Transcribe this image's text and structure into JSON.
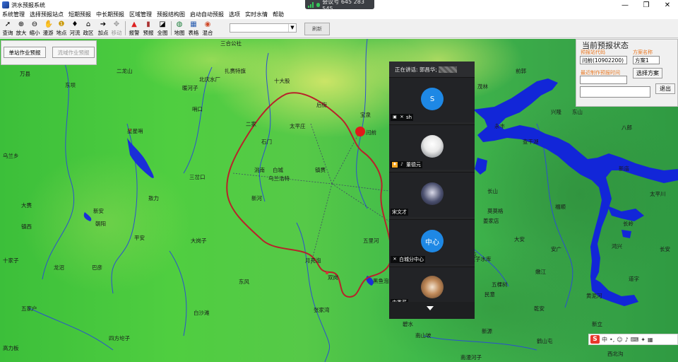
{
  "window": {
    "title": "洪水预报系统",
    "meeting_label": "会议号 645 283 545",
    "controls": {
      "minimize": "—",
      "maximize": "❐",
      "close": "✕"
    }
  },
  "menu": [
    "系统管理",
    "选择预报站点",
    "短期预报",
    "中长期预报",
    "区域管理",
    "预报结构图",
    "启动自动预报",
    "选项",
    "实时水情",
    "帮助"
  ],
  "toolbar": {
    "buttons": [
      {
        "label": "查询",
        "icon": "pointer-icon"
      },
      {
        "label": "放大",
        "icon": "zoom-in-icon"
      },
      {
        "label": "缩小",
        "icon": "zoom-out-icon"
      },
      {
        "label": "漫游",
        "icon": "hand-icon"
      },
      {
        "label": "地点",
        "icon": "info-icon"
      },
      {
        "label": "河流",
        "icon": "pin-icon"
      },
      {
        "label": "政区",
        "icon": "home-icon"
      },
      {
        "label": "加点",
        "icon": "arrow-icon"
      },
      {
        "label": "移动",
        "icon": "move-icon"
      },
      {
        "label": "报警",
        "icon": "alarm-icon"
      },
      {
        "label": "预报",
        "icon": "book-icon"
      },
      {
        "label": "全图",
        "icon": "chart-icon"
      },
      {
        "label": "地图",
        "icon": "globe-icon"
      },
      {
        "label": "表格",
        "icon": "table-icon"
      },
      {
        "label": "混合",
        "icon": "mix-icon"
      }
    ],
    "refresh_label": "刷新"
  },
  "left_panel": {
    "single_station_btn": "单站作业预报",
    "basin_btn": "流域作业预报"
  },
  "status_panel": {
    "title": "当前预报状态",
    "station_code_label": "预报站代码",
    "plan_name_label": "方案名称",
    "station_value": "闫前(10902200)",
    "plan_value": "方案1",
    "recent_time_label": "最近制作预报时间",
    "recent_time_value": "",
    "select_plan_btn": "选择方案",
    "exit_btn": "退出",
    "exit_field_value": ""
  },
  "video_panel": {
    "speaking_label": "正在讲话: 郭昌华;",
    "participants": [
      {
        "avatar_text": "S",
        "name": "sh",
        "avatar_color": "#1e88e5"
      },
      {
        "avatar_text": "",
        "name": "董德元",
        "avatar_color": "#cfd3d6"
      },
      {
        "avatar_text": "",
        "name": "宋文才",
        "avatar_color": "#3a3f56"
      },
      {
        "avatar_text": "中心",
        "name": "白城分中心",
        "avatar_color": "#1e88e5"
      },
      {
        "avatar_text": "",
        "name": "史秀芹",
        "avatar_color": "#b97a4e"
      }
    ]
  },
  "map_labels": [
    {
      "text": "三合公社"
    },
    {
      "text": "万县"
    },
    {
      "text": "二龙山"
    },
    {
      "text": "北庆水厂"
    },
    {
      "text": "扎赉特旗"
    },
    {
      "text": "暖河子"
    },
    {
      "text": "哨口"
    },
    {
      "text": "星星哨"
    },
    {
      "text": "十大股"
    },
    {
      "text": "后街"
    },
    {
      "text": "二家"
    },
    {
      "text": "太平庄"
    },
    {
      "text": "石门"
    },
    {
      "text": "宝泉"
    },
    {
      "text": "闫前"
    },
    {
      "text": "白城"
    },
    {
      "text": "洮南"
    },
    {
      "text": "镇赉"
    },
    {
      "text": "乌兰浩特"
    },
    {
      "text": "三岔口"
    },
    {
      "text": "东坝"
    },
    {
      "text": "大赉"
    },
    {
      "text": "新安"
    },
    {
      "text": "朝阳"
    },
    {
      "text": "大岗子"
    },
    {
      "text": "平安"
    },
    {
      "text": "五里河"
    },
    {
      "text": "月亮泡"
    },
    {
      "text": "龙沼"
    },
    {
      "text": "镇西"
    },
    {
      "text": "双岗"
    },
    {
      "text": "黑鱼泡"
    },
    {
      "text": "张家湾"
    },
    {
      "text": "东风"
    },
    {
      "text": "白沙滩"
    },
    {
      "text": "五家户"
    },
    {
      "text": "四方坨子"
    },
    {
      "text": "高力板"
    },
    {
      "text": "茂林"
    },
    {
      "text": "前郭"
    },
    {
      "text": "查干湖"
    },
    {
      "text": "长山"
    },
    {
      "text": "莫莫格"
    },
    {
      "text": "姜家店"
    },
    {
      "text": "三家子水库"
    },
    {
      "text": "大安"
    },
    {
      "text": "嫩江"
    },
    {
      "text": "安广"
    },
    {
      "text": "五棵树"
    },
    {
      "text": "民意"
    },
    {
      "text": "乾安"
    },
    {
      "text": "黄泥河"
    },
    {
      "text": "道字"
    },
    {
      "text": "鸿兴"
    },
    {
      "text": "新庙"
    },
    {
      "text": "长岭"
    },
    {
      "text": "太平川"
    },
    {
      "text": "新立"
    },
    {
      "text": "老岭"
    },
    {
      "text": "东山"
    },
    {
      "text": "福顺"
    },
    {
      "text": "八郎"
    },
    {
      "text": "长安"
    },
    {
      "text": "新源"
    },
    {
      "text": "南山坡"
    },
    {
      "text": "鹤山屯"
    },
    {
      "text": "西北沟"
    },
    {
      "text": "乌兰乡"
    },
    {
      "text": "敖力"
    },
    {
      "text": "永丰"
    },
    {
      "text": "兴隆"
    },
    {
      "text": "巴彦"
    },
    {
      "text": "十家子"
    },
    {
      "text": "新河"
    },
    {
      "text": "大屯"
    },
    {
      "text": "南漫河子"
    },
    {
      "text": "碧水"
    }
  ],
  "ime": {
    "logo": "S",
    "mode": "中",
    "punct": "•,"
  }
}
